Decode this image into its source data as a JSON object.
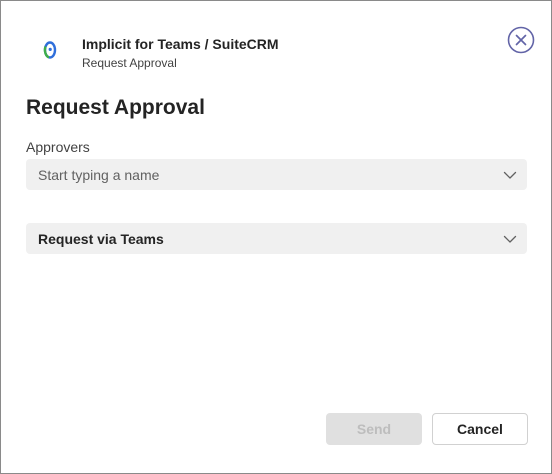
{
  "header": {
    "app_name": "Implicit for Teams / SuiteCRM",
    "subtitle": "Request Approval",
    "app_icon": "implicit-logo-icon"
  },
  "close_icon": "close-circle-icon",
  "title": "Request Approval",
  "approvers": {
    "label": "Approvers",
    "placeholder": "Start typing a name"
  },
  "request_method": {
    "selected": "Request via Teams"
  },
  "buttons": {
    "send": "Send",
    "cancel": "Cancel"
  },
  "colors": {
    "accent": "#6264a7",
    "logo_blue": "#2f6fdb",
    "logo_green": "#3fae49"
  }
}
